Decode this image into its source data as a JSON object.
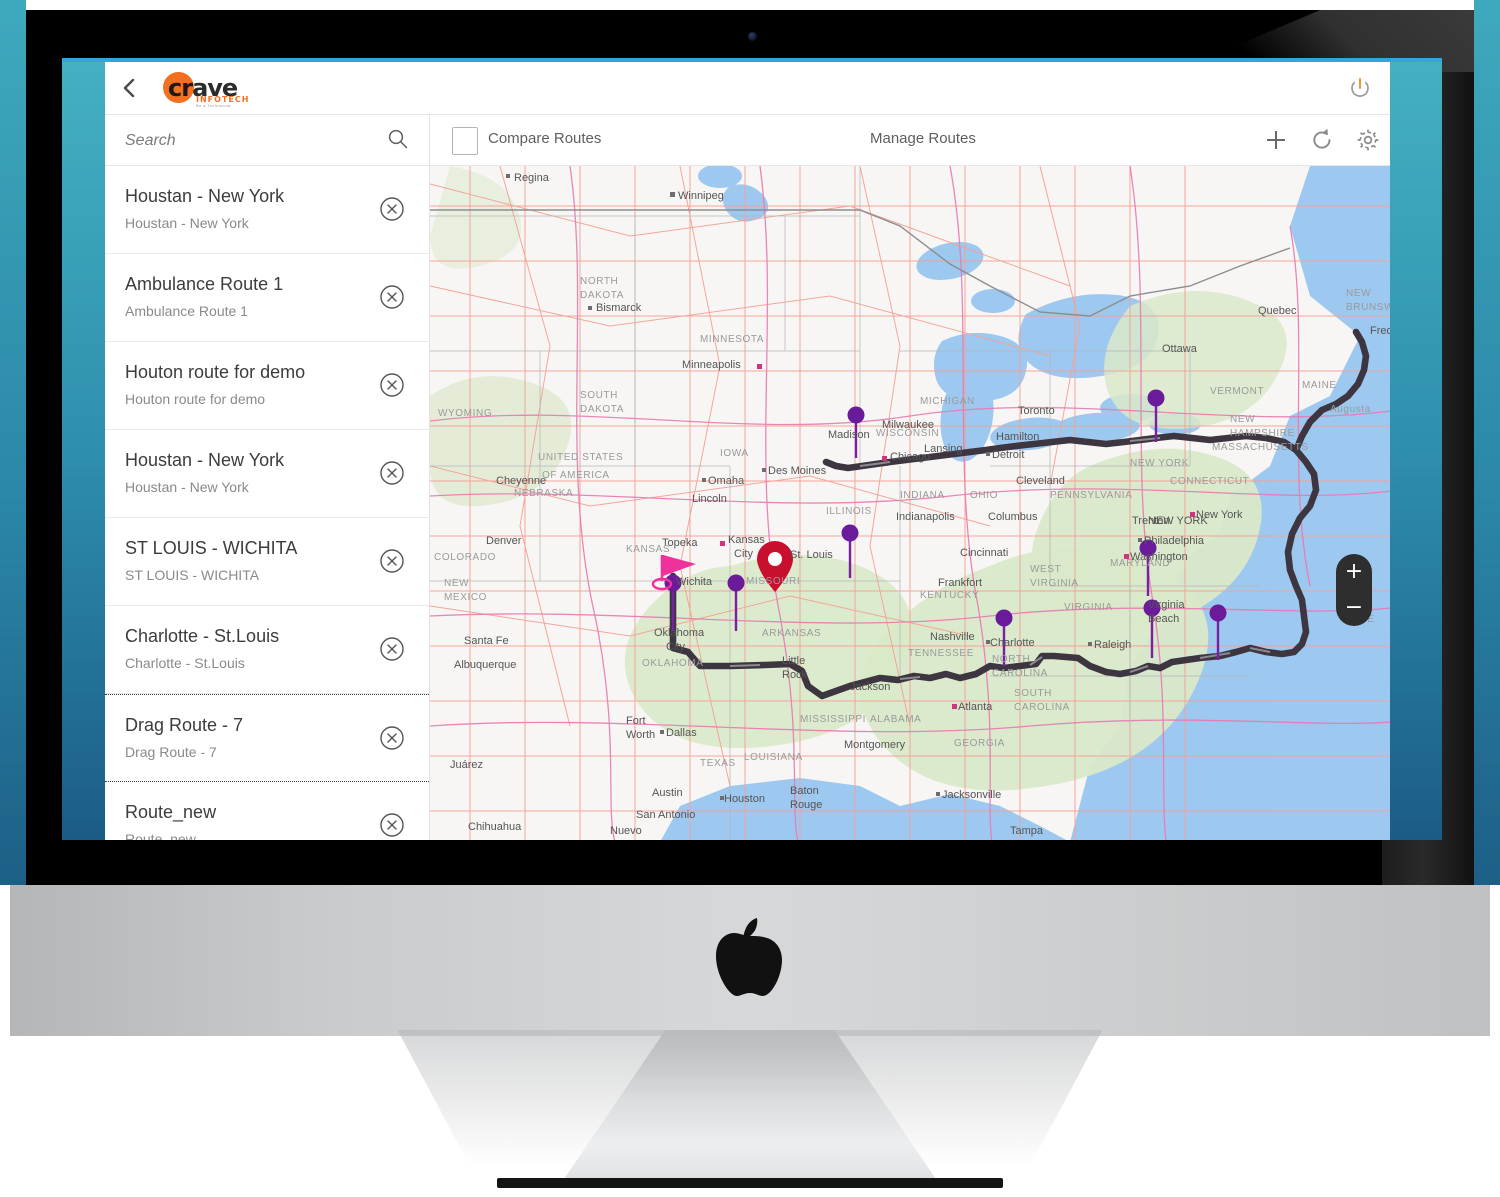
{
  "device": {
    "brand_logo": "apple-logo",
    "webcam": "webcam-dot"
  },
  "header": {
    "back_icon": "back-chevron-icon",
    "logo_word_cr": "cr",
    "logo_word_ave": "ave",
    "logo_sub": "INFOTECH",
    "logo_tagline": "Be a Technocrat",
    "power_icon": "power-icon"
  },
  "sidebar": {
    "search": {
      "placeholder": "Search",
      "value": "",
      "icon": "search-icon"
    },
    "routes": [
      {
        "title": "Houstan - New York",
        "subtitle": "Houstan - New York",
        "selected": false
      },
      {
        "title": "Ambulance Route 1",
        "subtitle": "Ambulance Route 1",
        "selected": false
      },
      {
        "title": "Houton route for demo",
        "subtitle": "Houton route for demo",
        "selected": false
      },
      {
        "title": "Houstan - New York",
        "subtitle": "Houstan - New York",
        "selected": false
      },
      {
        "title": "ST LOUIS - WICHITA",
        "subtitle": "ST LOUIS - WICHITA",
        "selected": false
      },
      {
        "title": "Charlotte - St.Louis",
        "subtitle": "Charlotte - St.Louis",
        "selected": false
      },
      {
        "title": "Drag Route - 7",
        "subtitle": "Drag Route - 7",
        "selected": true
      },
      {
        "title": "Route_new",
        "subtitle": "Route_new",
        "selected": false
      }
    ],
    "delete_icon": "delete-circle-icon"
  },
  "toolbar": {
    "compare_checkbox_checked": false,
    "compare_label": "Compare Routes",
    "manage_label": "Manage Routes",
    "add_icon": "plus-icon",
    "refresh_icon": "refresh-icon",
    "settings_icon": "gear-icon"
  },
  "map": {
    "zoom_in_label": "+",
    "zoom_out_label": "−",
    "origin_marker": "flag-marker-wichita",
    "destination_marker": "pin-marker-st-louis",
    "labels": [
      "Regina",
      "Winnipeg",
      "NORTH DAKOTA",
      "Bismarck",
      "MINNESOTA",
      "Minneapolis",
      "SOUTH DAKOTA",
      "UNITED STATES OF AMERICA",
      "WISCONSIN",
      "Milwaukee",
      "Madison",
      "MICHIGAN",
      "Lansing",
      "Toronto",
      "Hamilton",
      "Detroit",
      "Ottawa",
      "Quebec",
      "NEW BRUNSWICK",
      "MAINE",
      "Augusta",
      "VERMONT",
      "NEW HAMPSHIRE",
      "MASSACHUSETTS",
      "CONNECTICUT",
      "NEW YORK",
      "New York",
      "Philadelphia",
      "Trenton",
      "Washington",
      "MARYLAND",
      "Virginia Beach",
      "VIRGINIA",
      "WEST VIRGINIA",
      "Raleigh",
      "NORTH CAROLINA",
      "SOUTH CAROLINA",
      "Charlotte",
      "Atlanta",
      "GEORGIA",
      "Jacksonville",
      "Tampa",
      "ALABAMA",
      "Montgomery",
      "MISSISSIPPI",
      "Jackson",
      "LOUISIANA",
      "Baton Rouge",
      "Houston",
      "Austin",
      "San Antonio",
      "TEXAS",
      "Dallas",
      "Fort Worth",
      "Juárez",
      "Chihuahua",
      "Nuevo",
      "NEW MEXICO",
      "Albuquerque",
      "Santa Fe",
      "COLORADO",
      "Denver",
      "Cheyenne",
      "WYOMING",
      "NEBRASKA",
      "Lincoln",
      "Omaha",
      "IOWA",
      "Des Moines",
      "Kansas City",
      "Topeka",
      "KANSAS",
      "Wichita",
      "OKLAHOMA",
      "Oklahoma City",
      "ARKANSAS",
      "Little Rock",
      "MISSOURI",
      "St. Louis",
      "ILLINOIS",
      "Chicago",
      "INDIANA",
      "Indianapolis",
      "OHIO",
      "Columbus",
      "Cleveland",
      "Cincinnati",
      "Frankfort",
      "KENTUCKY",
      "TENNESSEE",
      "Nashville",
      "PENNSYLVANIA"
    ],
    "colors": {
      "route_line": "#3d3640",
      "waypoint": "#7b1fa2",
      "destination_pin": "#d00020",
      "origin_flag": "#f0319b",
      "water": "#9dc8f0",
      "land_green": "#d6e8c8",
      "land_base": "#f6f5f3",
      "road": "#f59a8a",
      "highway": "#e87ab0"
    }
  }
}
